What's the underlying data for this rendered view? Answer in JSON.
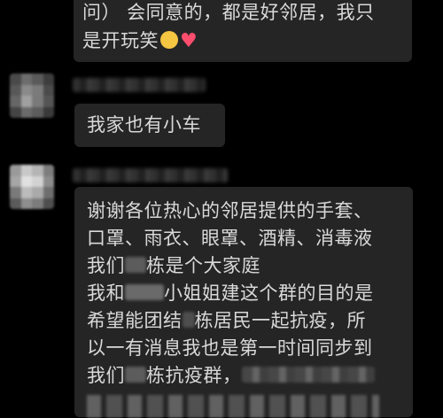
{
  "messages": [
    {
      "lines": [
        "问） 会同意的，都是好邻居，我只",
        "是开玩笑"
      ],
      "emojis": [
        "thinking-face-icon",
        "pink-heart-icon"
      ]
    },
    {
      "text": "我家也有小车"
    },
    {
      "lines": [
        "谢谢各位热心的邻居提供的手套、",
        "口罩、雨衣、眼罩、酒精、消毒液",
        [
          "我们",
          "栋是个大家庭"
        ],
        [
          "我和",
          "小姐姐建这个群的目的是"
        ],
        [
          "希望能团结",
          "栋居民一起抗疫，所"
        ],
        "以一有消息我也是第一时间同步到",
        [
          "我们",
          "栋抗疫群，"
        ]
      ]
    }
  ],
  "colors": {
    "background": "#000000",
    "bubble": "#252525",
    "text": "#d9d9d9"
  }
}
